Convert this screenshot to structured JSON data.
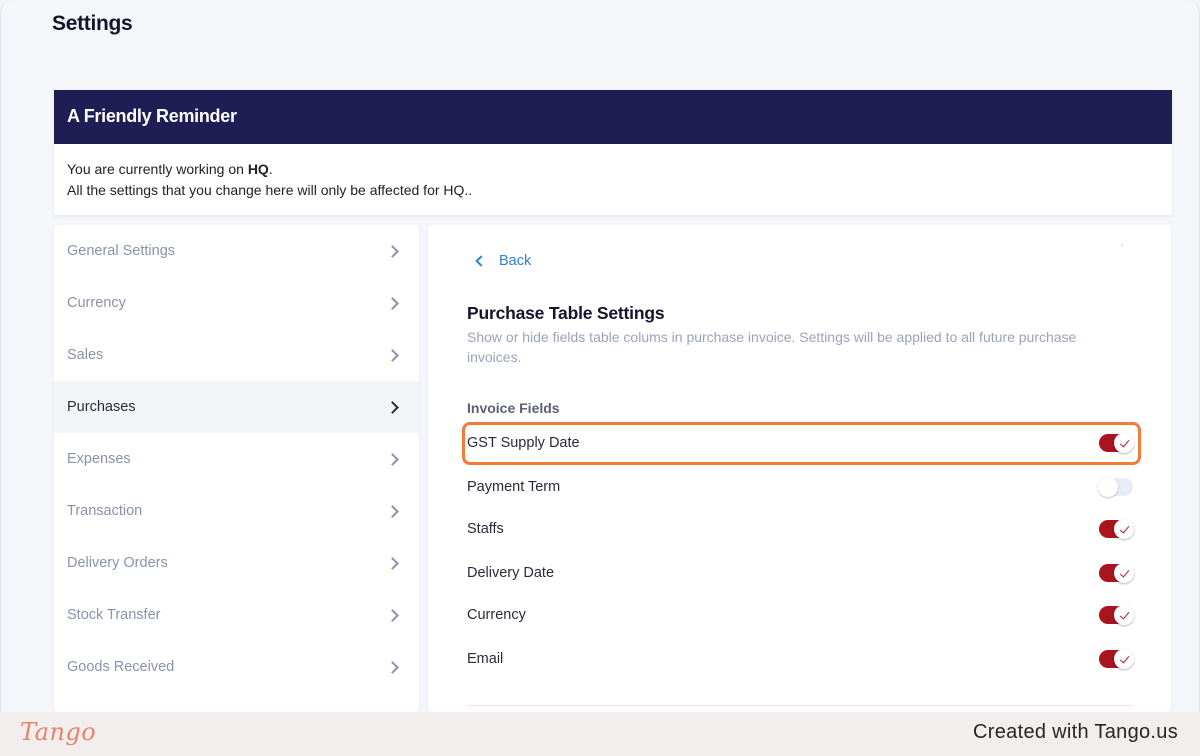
{
  "page": {
    "title": "Settings"
  },
  "reminder": {
    "title": "A Friendly Reminder",
    "line1_prefix": "You are currently working on ",
    "line1_bold": "HQ",
    "line1_suffix": ".",
    "line2": "All the settings that you change here will only be affected for HQ.."
  },
  "sidebar": {
    "items": [
      {
        "label": "General Settings",
        "active": false
      },
      {
        "label": "Currency",
        "active": false
      },
      {
        "label": "Sales",
        "active": false
      },
      {
        "label": "Purchases",
        "active": true
      },
      {
        "label": "Expenses",
        "active": false
      },
      {
        "label": "Transaction",
        "active": false
      },
      {
        "label": "Delivery Orders",
        "active": false
      },
      {
        "label": "Stock Transfer",
        "active": false
      },
      {
        "label": "Goods Received",
        "active": false
      }
    ]
  },
  "panel": {
    "back_label": "Back",
    "title": "Purchase Table Settings",
    "description": "Show or hide fields table colums in purchase invoice. Settings will be applied to all future purchase invoices.",
    "section_label": "Invoice Fields",
    "fields": [
      {
        "label": "GST Supply Date",
        "enabled": true
      },
      {
        "label": "Payment Term",
        "enabled": false
      },
      {
        "label": "Staffs",
        "enabled": true
      },
      {
        "label": "Delivery Date",
        "enabled": true
      },
      {
        "label": "Currency",
        "enabled": true
      },
      {
        "label": "Email",
        "enabled": true
      }
    ]
  },
  "colors": {
    "reminder_header": "#1e1e55",
    "toggle_on": "#a9141f",
    "highlight": "#f47a3a",
    "link": "#2f7fd6"
  },
  "footer": {
    "logo": "Tango",
    "created_text": "Created with Tango.us"
  }
}
